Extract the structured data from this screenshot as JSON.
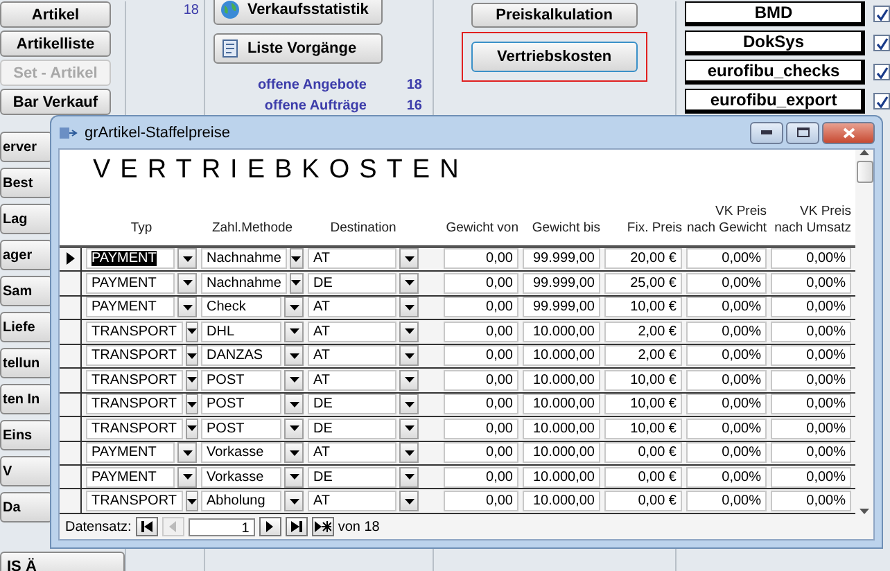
{
  "background": {
    "left_buttons": [
      {
        "label": "Artikel",
        "disabled": false
      },
      {
        "label": "Artikelliste",
        "disabled": false
      },
      {
        "label": "Set - Artikel",
        "disabled": true
      },
      {
        "label": "Bar Verkauf",
        "disabled": false
      }
    ],
    "left_count": "18",
    "covered_buttons": [
      "erver",
      "Best",
      "Lag",
      "ager",
      "Sam",
      "Liefe",
      "tellun",
      "ten In",
      "Eins",
      "V",
      "Da"
    ],
    "bottom_button": "IS Ä",
    "middle_buttons": [
      {
        "label": "Verkaufsstatistik",
        "kind": "globe"
      },
      {
        "label": "Liste Vorgänge",
        "kind": "list"
      }
    ],
    "stats": [
      {
        "label": "offene Angebote",
        "count": "18"
      },
      {
        "label": "offene Aufträge",
        "count": "16"
      }
    ],
    "right_buttons": [
      {
        "label": "Preiskalkulation",
        "highlighted": false
      },
      {
        "label": "Vertriebskosten",
        "highlighted": true
      }
    ],
    "exports": [
      {
        "label": "BMD",
        "checked": true
      },
      {
        "label": "DokSys",
        "checked": true
      },
      {
        "label": "eurofibu_checks",
        "checked": true
      },
      {
        "label": "eurofibu_export",
        "checked": true
      }
    ]
  },
  "dialog": {
    "title": "grArtikel-Staffelpreise",
    "heading": "VERTRIEBKOSTEN",
    "columns": [
      "Typ",
      "Zahl.Methode",
      "Destination",
      "Gewicht von",
      "Gewicht bis",
      "Fix. Preis",
      "VK Preis nach Gewicht",
      "VK Preis nach Umsatz"
    ],
    "rows": [
      {
        "selected": true,
        "cells": [
          "PAYMENT",
          "Nachnahme",
          "AT",
          "0,00",
          "99.999,00",
          "20,00 €",
          "0,00%",
          "0,00%"
        ]
      },
      {
        "selected": false,
        "cells": [
          "PAYMENT",
          "Nachnahme",
          "DE",
          "0,00",
          "99.999,00",
          "25,00 €",
          "0,00%",
          "0,00%"
        ]
      },
      {
        "selected": false,
        "cells": [
          "PAYMENT",
          "Check",
          "AT",
          "0,00",
          "99.999,00",
          "10,00 €",
          "0,00%",
          "0,00%"
        ]
      },
      {
        "selected": false,
        "cells": [
          "TRANSPORT",
          "DHL",
          "AT",
          "0,00",
          "10.000,00",
          "2,00 €",
          "0,00%",
          "0,00%"
        ]
      },
      {
        "selected": false,
        "cells": [
          "TRANSPORT",
          "DANZAS",
          "AT",
          "0,00",
          "10.000,00",
          "2,00 €",
          "0,00%",
          "0,00%"
        ]
      },
      {
        "selected": false,
        "cells": [
          "TRANSPORT",
          "POST",
          "AT",
          "0,00",
          "10.000,00",
          "10,00 €",
          "0,00%",
          "0,00%"
        ]
      },
      {
        "selected": false,
        "cells": [
          "TRANSPORT",
          "POST",
          "DE",
          "0,00",
          "10.000,00",
          "10,00 €",
          "0,00%",
          "0,00%"
        ]
      },
      {
        "selected": false,
        "cells": [
          "TRANSPORT",
          "POST",
          "DE",
          "0,00",
          "10.000,00",
          "10,00 €",
          "0,00%",
          "0,00%"
        ]
      },
      {
        "selected": false,
        "cells": [
          "PAYMENT",
          "Vorkasse",
          "AT",
          "0,00",
          "10.000,00",
          "0,00 €",
          "0,00%",
          "0,00%"
        ]
      },
      {
        "selected": false,
        "cells": [
          "PAYMENT",
          "Vorkasse",
          "DE",
          "0,00",
          "10.000,00",
          "0,00 €",
          "0,00%",
          "0,00%"
        ]
      },
      {
        "selected": false,
        "cells": [
          "TRANSPORT",
          "Abholung",
          "AT",
          "0,00",
          "10.000,00",
          "0,00 €",
          "0,00%",
          "0,00%"
        ]
      }
    ],
    "navigator": {
      "label": "Datensatz:",
      "record": "1",
      "total": "von 18"
    }
  }
}
